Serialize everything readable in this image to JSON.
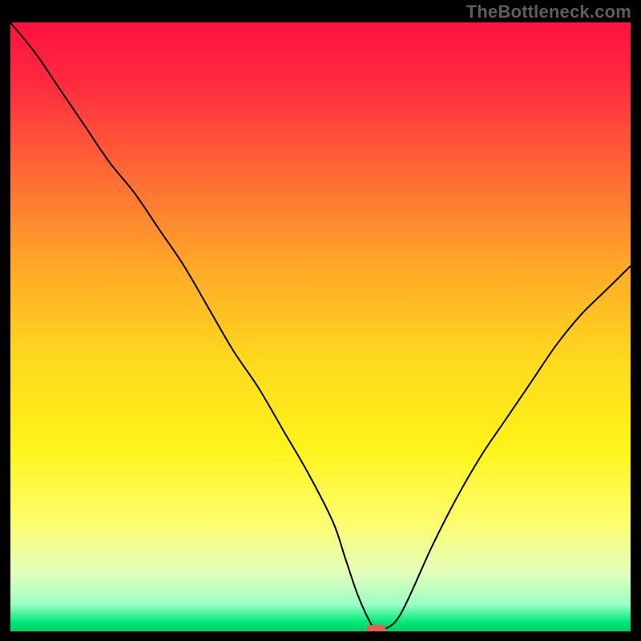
{
  "watermark": "TheBottleneck.com",
  "chart_data": {
    "type": "line",
    "title": "",
    "xlabel": "",
    "ylabel": "",
    "xlim": [
      0,
      100
    ],
    "ylim": [
      0,
      100
    ],
    "grid": false,
    "legend": false,
    "background": "rainbow-gradient",
    "gradient_stops": [
      {
        "offset": 0.0,
        "color": "#ff1040"
      },
      {
        "offset": 0.1,
        "color": "#ff2b3f"
      },
      {
        "offset": 0.25,
        "color": "#ff6a34"
      },
      {
        "offset": 0.4,
        "color": "#ffa828"
      },
      {
        "offset": 0.55,
        "color": "#ffd81e"
      },
      {
        "offset": 0.7,
        "color": "#fff41a"
      },
      {
        "offset": 0.82,
        "color": "#fdfd6e"
      },
      {
        "offset": 0.9,
        "color": "#e6ffb8"
      },
      {
        "offset": 0.955,
        "color": "#9dffc7"
      },
      {
        "offset": 0.985,
        "color": "#00e878"
      },
      {
        "offset": 1.0,
        "color": "#00d060"
      }
    ],
    "series": [
      {
        "name": "bottleneck-curve",
        "color": "#000000",
        "stroke_width": 2,
        "x": [
          0,
          4,
          8,
          12,
          16,
          20,
          24,
          28,
          32,
          36,
          40,
          44,
          48,
          52,
          54,
          56,
          58,
          59,
          60,
          62,
          64,
          68,
          72,
          76,
          80,
          84,
          88,
          92,
          96,
          100
        ],
        "y": [
          100,
          95,
          89,
          83,
          77,
          72,
          66,
          60,
          53,
          46,
          40,
          33,
          26,
          18,
          12,
          6,
          1.5,
          0.3,
          0.3,
          1.5,
          5,
          14,
          22,
          29,
          35,
          41,
          47,
          52,
          56,
          60
        ]
      }
    ],
    "marker": {
      "name": "optimal-point",
      "x": 59,
      "y": 0.3,
      "color": "#e4605b",
      "rx": 12,
      "ry": 6
    }
  }
}
